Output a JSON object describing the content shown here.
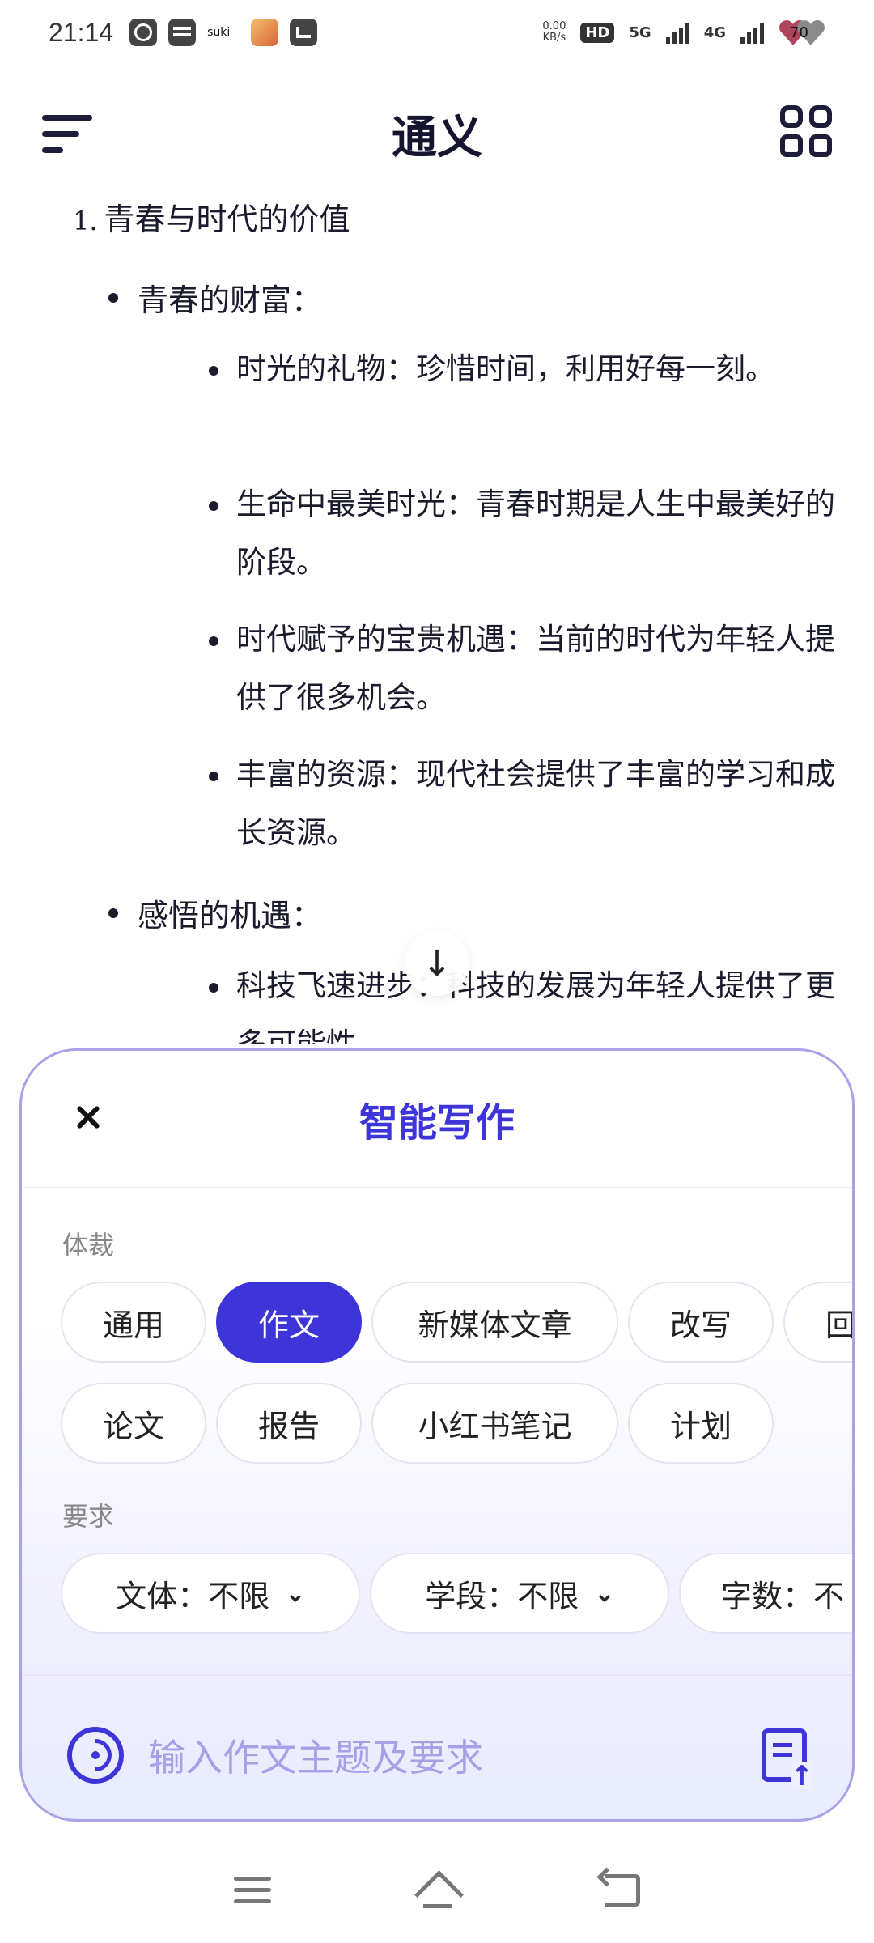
{
  "status_bar": {
    "time": "21:14",
    "app_icon_text": "suki",
    "net_speed_value": "0.00",
    "net_speed_unit": "KB/s",
    "hd_label": "HD",
    "sim1_label": "5G",
    "sim2_label": "4G",
    "battery": "70"
  },
  "app_bar": {
    "title": "通义"
  },
  "content": {
    "section_number": "1.",
    "section_title": "青春与时代的价值",
    "groups": [
      {
        "label": "青春的财富：",
        "items": [
          "时光的礼物：珍惜时间，利用好每一刻。",
          "生命中最美时光：青春时期是人生中最美好的阶段。",
          "时代赋予的宝贵机遇：当前的时代为年轻人提供了很多机会。",
          "丰富的资源：现代社会提供了丰富的学习和成长资源。"
        ]
      },
      {
        "label": "感悟的机遇：",
        "items": [
          "科技飞速进步：科技的发展为年轻人提供了更多可能性。"
        ]
      }
    ]
  },
  "panel": {
    "title": "智能写作",
    "genre_label": "体裁",
    "genres_row1": [
      "通用",
      "作文",
      "新媒体文章",
      "改写",
      "回"
    ],
    "genres_row2": [
      "论文",
      "报告",
      "小红书笔记",
      "计划"
    ],
    "active_genre": "作文",
    "requirements_label": "要求",
    "requirements": [
      "文体：不限",
      "学段：不限",
      "字数：不"
    ],
    "input_placeholder": "输入作文主题及要求"
  },
  "colors": {
    "accent": "#3d35d8",
    "panel_border": "#a9a2e6",
    "placeholder": "#a6a0e6"
  }
}
